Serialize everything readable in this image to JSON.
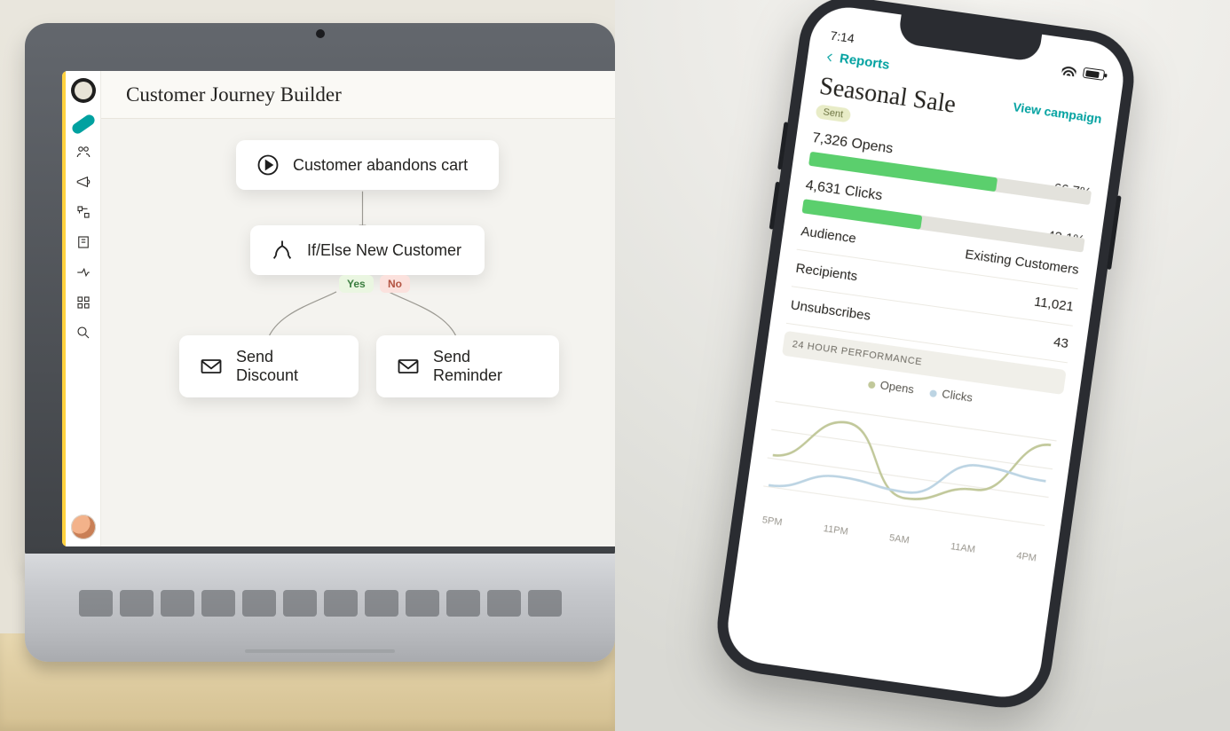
{
  "laptop": {
    "page_title": "Customer Journey Builder",
    "sidebar_icons": [
      "logo",
      "active-pill",
      "audience",
      "campaigns",
      "automations",
      "content",
      "integrations",
      "apps",
      "search",
      "avatar"
    ],
    "nodes": {
      "start": {
        "label": "Customer abandons cart"
      },
      "condition": {
        "label": "If/Else New Customer"
      },
      "branch_yes": {
        "label": "Yes"
      },
      "branch_no": {
        "label": "No"
      },
      "action_yes": {
        "label": "Send Discount"
      },
      "action_no": {
        "label": "Send Reminder"
      }
    }
  },
  "phone": {
    "status_time": "7:14",
    "back_label": "Reports",
    "title": "Seasonal Sale",
    "status_pill": "Sent",
    "view_link": "View campaign",
    "opens": {
      "value": "7,326",
      "word": "Opens",
      "pct": "66.7%",
      "trend": "up",
      "fill_pct": 66.7
    },
    "clicks": {
      "value": "4,631",
      "word": "Clicks",
      "pct": "42.1%",
      "fill_pct": 42.1
    },
    "rows": {
      "audience": {
        "label": "Audience",
        "value": "Existing Customers"
      },
      "recipients": {
        "label": "Recipients",
        "value": "11,021"
      },
      "unsubscribes": {
        "label": "Unsubscribes",
        "value": "43"
      }
    },
    "section_header": "24 HOUR PERFORMANCE",
    "legend": {
      "opens": "Opens",
      "clicks": "Clicks"
    },
    "chart_data": {
      "type": "line",
      "x_labels": [
        "5PM",
        "11PM",
        "5AM",
        "11AM",
        "4PM"
      ],
      "series": [
        {
          "name": "Opens",
          "values": [
            45,
            80,
            25,
            40,
            85
          ]
        },
        {
          "name": "Clicks",
          "values": [
            20,
            35,
            30,
            60,
            55
          ]
        }
      ],
      "ylim": [
        0,
        100
      ]
    }
  }
}
